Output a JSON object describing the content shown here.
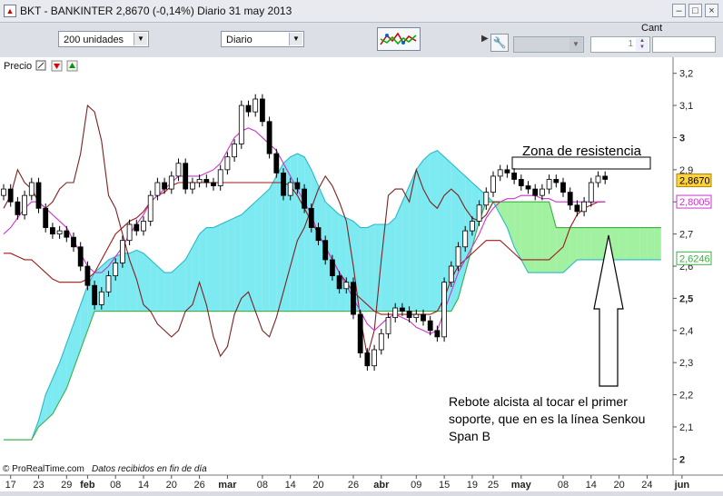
{
  "window": {
    "title": "BKT - BANKINTER    2,8670 (-0,14%)   Diario  31 may 2013",
    "min_icon": "minimize-icon",
    "max_icon": "maximize-icon",
    "close_icon": "close-icon"
  },
  "toolbar": {
    "units_value": "200 unidades",
    "period_value": "Diario",
    "cant_label": "Cant",
    "qty_value": "1"
  },
  "panel": {
    "label": "Precio"
  },
  "footer": {
    "copyright": "© ProRealTime.com",
    "note": "Datos recibidos en fin de día"
  },
  "annotations": {
    "resistance": "Zona de resistencia",
    "rebound_1": "Rebote alcista al tocar el primer",
    "rebound_2": "soporte, que en es la línea Senkou",
    "rebound_3": "Span B"
  },
  "price_labels": {
    "last": "2,8670",
    "tenkan": "2,8005",
    "senkou_b": "2,6246"
  },
  "colors": {
    "tenkan": "#cc33cc",
    "kijun": "#a01818",
    "chikou": "#7a2222",
    "cloud_bull": "#66e6ee",
    "cloud_bear": "#90ee90",
    "candle": "#000000"
  },
  "chart_data": {
    "type": "candlestick",
    "title": "BKT - BANKINTER",
    "ylim": [
      1.95,
      3.25
    ],
    "yticks": [
      "3,2",
      "3,1",
      "3",
      "2,9",
      "2,8",
      "2,7",
      "2,6",
      "2,5",
      "2,4",
      "2,3",
      "2,2",
      "2,1",
      "2"
    ],
    "ytick_values": [
      3.2,
      3.1,
      3.0,
      2.9,
      2.8,
      2.7,
      2.6,
      2.5,
      2.4,
      2.3,
      2.2,
      2.1,
      2.0
    ],
    "xticks": [
      "17",
      "23",
      "29",
      "feb",
      "08",
      "14",
      "20",
      "26",
      "mar",
      "08",
      "14",
      "20",
      "26",
      "abr",
      "09",
      "15",
      "19",
      "25",
      "may",
      "08",
      "14",
      "20",
      "24",
      "jun"
    ],
    "xtick_index": [
      1,
      5,
      9,
      12,
      16,
      20,
      24,
      28,
      32,
      37,
      41,
      45,
      50,
      54,
      59,
      63,
      67,
      70,
      74,
      80,
      84,
      88,
      92,
      97
    ],
    "closes": [
      2.84,
      2.8,
      2.76,
      2.82,
      2.86,
      2.78,
      2.72,
      2.7,
      2.71,
      2.69,
      2.66,
      2.6,
      2.54,
      2.48,
      2.52,
      2.57,
      2.61,
      2.68,
      2.73,
      2.71,
      2.74,
      2.82,
      2.86,
      2.84,
      2.88,
      2.92,
      2.84,
      2.86,
      2.87,
      2.86,
      2.85,
      2.9,
      2.94,
      2.98,
      3.1,
      3.08,
      3.12,
      3.05,
      2.95,
      2.89,
      2.82,
      2.86,
      2.84,
      2.78,
      2.72,
      2.68,
      2.62,
      2.57,
      2.53,
      2.55,
      2.45,
      2.33,
      2.29,
      2.34,
      2.39,
      2.44,
      2.47,
      2.46,
      2.44,
      2.45,
      2.43,
      2.4,
      2.38,
      2.55,
      2.6,
      2.66,
      2.71,
      2.74,
      2.79,
      2.83,
      2.88,
      2.9,
      2.89,
      2.87,
      2.85,
      2.84,
      2.82,
      2.84,
      2.87,
      2.86,
      2.83,
      2.79,
      2.77,
      2.8,
      2.86,
      2.88,
      2.87
    ],
    "opens": [
      2.82,
      2.84,
      2.8,
      2.76,
      2.82,
      2.86,
      2.78,
      2.72,
      2.7,
      2.71,
      2.69,
      2.66,
      2.6,
      2.54,
      2.48,
      2.52,
      2.57,
      2.61,
      2.68,
      2.73,
      2.71,
      2.74,
      2.82,
      2.86,
      2.84,
      2.88,
      2.92,
      2.84,
      2.86,
      2.87,
      2.86,
      2.85,
      2.9,
      2.94,
      2.98,
      3.1,
      3.08,
      3.12,
      3.05,
      2.95,
      2.89,
      2.82,
      2.86,
      2.84,
      2.78,
      2.72,
      2.68,
      2.62,
      2.57,
      2.53,
      2.55,
      2.45,
      2.33,
      2.29,
      2.34,
      2.39,
      2.44,
      2.47,
      2.46,
      2.44,
      2.45,
      2.43,
      2.4,
      2.38,
      2.55,
      2.6,
      2.66,
      2.71,
      2.74,
      2.79,
      2.83,
      2.88,
      2.9,
      2.89,
      2.87,
      2.85,
      2.84,
      2.82,
      2.84,
      2.87,
      2.86,
      2.83,
      2.79,
      2.77,
      2.8,
      2.86,
      2.88
    ],
    "tenkan": [
      2.7,
      2.72,
      2.75,
      2.78,
      2.8,
      2.8,
      2.78,
      2.76,
      2.74,
      2.72,
      2.68,
      2.64,
      2.6,
      2.58,
      2.58,
      2.6,
      2.63,
      2.66,
      2.7,
      2.73,
      2.76,
      2.8,
      2.82,
      2.84,
      2.86,
      2.88,
      2.88,
      2.88,
      2.88,
      2.89,
      2.9,
      2.92,
      2.96,
      3.0,
      3.02,
      3.03,
      3.02,
      3.0,
      2.98,
      2.96,
      2.92,
      2.88,
      2.84,
      2.8,
      2.76,
      2.7,
      2.66,
      2.62,
      2.58,
      2.54,
      2.5,
      2.46,
      2.42,
      2.4,
      2.42,
      2.44,
      2.45,
      2.44,
      2.43,
      2.41,
      2.4,
      2.39,
      2.4,
      2.46,
      2.52,
      2.58,
      2.62,
      2.66,
      2.7,
      2.75,
      2.78,
      2.8,
      2.81,
      2.81,
      2.82,
      2.82,
      2.82,
      2.81,
      2.81,
      2.8,
      2.8,
      2.8,
      2.8,
      2.8,
      2.8,
      2.8,
      2.8
    ],
    "kijun": [
      2.64,
      2.64,
      2.63,
      2.62,
      2.62,
      2.6,
      2.58,
      2.56,
      2.55,
      2.55,
      2.55,
      2.55,
      2.56,
      2.58,
      2.62,
      2.66,
      2.7,
      2.72,
      2.74,
      2.75,
      2.77,
      2.8,
      2.82,
      2.83,
      2.85,
      2.86,
      2.86,
      2.86,
      2.86,
      2.86,
      2.86,
      2.86,
      2.86,
      2.86,
      2.86,
      2.86,
      2.86,
      2.86,
      2.86,
      2.86,
      2.86,
      2.85,
      2.82,
      2.78,
      2.74,
      2.7,
      2.66,
      2.62,
      2.58,
      2.55,
      2.52,
      2.5,
      2.48,
      2.46,
      2.45,
      2.45,
      2.45,
      2.45,
      2.45,
      2.45,
      2.45,
      2.45,
      2.46,
      2.5,
      2.56,
      2.6,
      2.62,
      2.64,
      2.66,
      2.68,
      2.68,
      2.68,
      2.66,
      2.64,
      2.62,
      2.62,
      2.62,
      2.62,
      2.62,
      2.64,
      2.66,
      2.72,
      2.76,
      2.78,
      2.79,
      2.8,
      2.8
    ],
    "senkou_a": [
      2.06,
      2.06,
      2.06,
      2.06,
      2.06,
      2.12,
      2.2,
      2.25,
      2.3,
      2.36,
      2.42,
      2.48,
      2.54,
      2.58,
      2.6,
      2.62,
      2.63,
      2.64,
      2.64,
      2.65,
      2.64,
      2.62,
      2.6,
      2.58,
      2.58,
      2.6,
      2.62,
      2.66,
      2.7,
      2.72,
      2.72,
      2.73,
      2.74,
      2.75,
      2.76,
      2.78,
      2.8,
      2.82,
      2.84,
      2.88,
      2.92,
      2.94,
      2.95,
      2.94,
      2.9,
      2.85,
      2.8,
      2.78,
      2.76,
      2.75,
      2.74,
      2.72,
      2.72,
      2.73,
      2.73,
      2.73,
      2.75,
      2.8,
      2.85,
      2.9,
      2.93,
      2.95,
      2.96,
      2.94,
      2.92,
      2.9,
      2.88,
      2.86,
      2.84,
      2.82,
      2.8,
      2.76,
      2.72,
      2.66,
      2.62,
      2.58,
      2.58,
      2.58,
      2.58,
      2.58,
      2.58,
      2.6,
      2.62,
      2.62,
      2.62,
      2.62,
      2.62,
      2.62,
      2.62,
      2.62,
      2.62,
      2.62,
      2.62,
      2.62,
      2.62
    ],
    "senkou_b": [
      2.06,
      2.06,
      2.06,
      2.06,
      2.06,
      2.1,
      2.12,
      2.14,
      2.18,
      2.22,
      2.28,
      2.34,
      2.4,
      2.46,
      2.46,
      2.46,
      2.46,
      2.46,
      2.46,
      2.46,
      2.46,
      2.46,
      2.46,
      2.46,
      2.46,
      2.46,
      2.46,
      2.46,
      2.46,
      2.46,
      2.46,
      2.46,
      2.46,
      2.46,
      2.46,
      2.46,
      2.46,
      2.46,
      2.46,
      2.46,
      2.46,
      2.46,
      2.46,
      2.46,
      2.46,
      2.46,
      2.46,
      2.46,
      2.46,
      2.46,
      2.46,
      2.46,
      2.46,
      2.46,
      2.46,
      2.46,
      2.46,
      2.46,
      2.46,
      2.46,
      2.46,
      2.46,
      2.46,
      2.46,
      2.46,
      2.5,
      2.58,
      2.66,
      2.74,
      2.8,
      2.8,
      2.8,
      2.8,
      2.8,
      2.8,
      2.8,
      2.8,
      2.8,
      2.8,
      2.72,
      2.72,
      2.72,
      2.72,
      2.72,
      2.72,
      2.72,
      2.72,
      2.72,
      2.72,
      2.72,
      2.72,
      2.72,
      2.72,
      2.72,
      2.72
    ],
    "chikou": [
      2.78,
      2.82,
      2.9,
      2.86,
      2.84,
      2.8,
      2.78,
      2.8,
      2.84,
      2.86,
      2.86,
      2.95,
      3.1,
      3.08,
      2.99,
      2.82,
      2.78,
      2.7,
      2.62,
      2.56,
      2.48,
      2.46,
      2.42,
      2.4,
      2.38,
      2.4,
      2.46,
      2.48,
      2.55,
      2.48,
      2.38,
      2.32,
      2.35,
      2.45,
      2.5,
      2.52,
      2.46,
      2.4,
      2.38,
      2.44,
      2.52,
      2.6,
      2.68,
      2.72,
      2.78,
      2.84,
      2.88,
      2.85,
      2.8,
      2.74,
      2.6,
      2.44,
      2.32,
      2.4,
      2.62,
      2.82,
      2.84,
      2.84,
      2.8,
      2.9,
      2.84,
      2.8,
      2.78,
      2.82,
      2.84,
      2.82,
      2.78,
      2.75,
      2.74,
      2.76,
      2.8,
      2.8
    ],
    "resistance_band": [
      2.88,
      2.92
    ],
    "annotations": [
      "Zona de resistencia",
      "Rebote alcista al tocar el primer soporte, que en es la línea Senkou Span B"
    ]
  }
}
